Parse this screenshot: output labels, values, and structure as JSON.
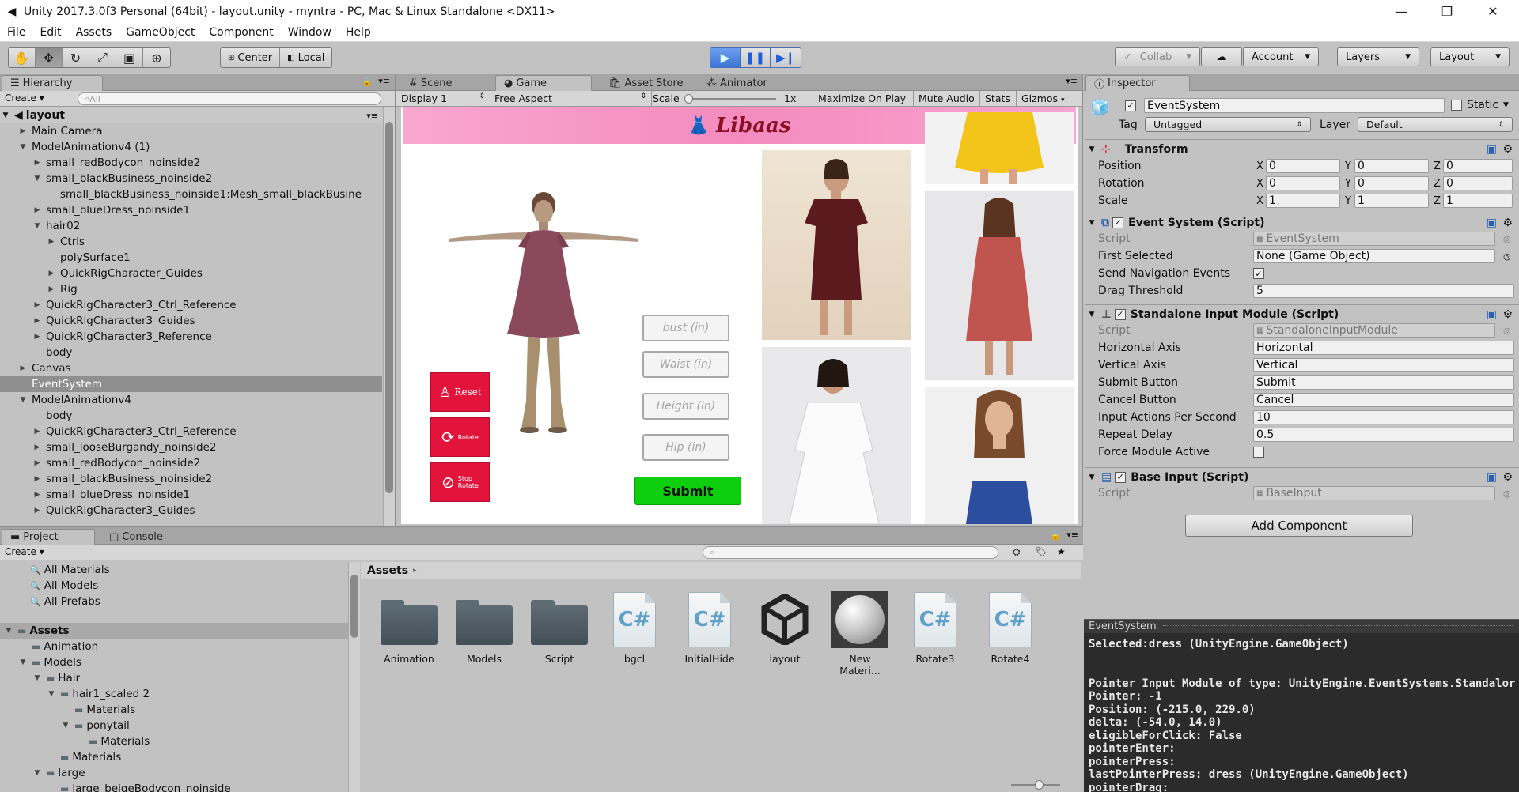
{
  "window": {
    "title": "Unity 2017.3.0f3 Personal (64bit) - layout.unity - myntra - PC, Mac & Linux Standalone <DX11>",
    "minimize": "—",
    "restore": "❐",
    "close": "✕"
  },
  "menu": [
    "File",
    "Edit",
    "Assets",
    "GameObject",
    "Component",
    "Window",
    "Help"
  ],
  "toolbar": {
    "pivot": "Center",
    "space": "Local",
    "collab": "Collab",
    "account": "Account",
    "layers": "Layers",
    "layout": "Layout"
  },
  "hierarchy": {
    "tab": "Hierarchy",
    "create": "Create",
    "search_placeholder": "All",
    "scene": "layout",
    "rows": [
      {
        "label": "Main Camera",
        "indent": 1,
        "tri": "▶"
      },
      {
        "label": "ModelAnimationv4 (1)",
        "indent": 1,
        "tri": "▼"
      },
      {
        "label": "small_redBodycon_noinside2",
        "indent": 2,
        "tri": "▶"
      },
      {
        "label": "small_blackBusiness_noinside2",
        "indent": 2,
        "tri": "▼"
      },
      {
        "label": "small_blackBusiness_noinside1:Mesh_small_blackBusine",
        "indent": 3,
        "tri": ""
      },
      {
        "label": "small_blueDress_noinside1",
        "indent": 2,
        "tri": "▶"
      },
      {
        "label": "hair02",
        "indent": 2,
        "tri": "▼"
      },
      {
        "label": "Ctrls",
        "indent": 3,
        "tri": "▶"
      },
      {
        "label": "polySurface1",
        "indent": 3,
        "tri": ""
      },
      {
        "label": "QuickRigCharacter_Guides",
        "indent": 3,
        "tri": "▶"
      },
      {
        "label": "Rig",
        "indent": 3,
        "tri": "▶"
      },
      {
        "label": "QuickRigCharacter3_Ctrl_Reference",
        "indent": 2,
        "tri": "▶"
      },
      {
        "label": "QuickRigCharacter3_Guides",
        "indent": 2,
        "tri": "▶"
      },
      {
        "label": "QuickRigCharacter3_Reference",
        "indent": 2,
        "tri": "▶"
      },
      {
        "label": "body",
        "indent": 2,
        "tri": ""
      },
      {
        "label": "Canvas",
        "indent": 1,
        "tri": "▶"
      },
      {
        "label": "EventSystem",
        "indent": 1,
        "tri": "",
        "selected": true
      },
      {
        "label": "ModelAnimationv4",
        "indent": 1,
        "tri": "▼"
      },
      {
        "label": "body",
        "indent": 2,
        "tri": ""
      },
      {
        "label": "QuickRigCharacter3_Ctrl_Reference",
        "indent": 2,
        "tri": "▶"
      },
      {
        "label": "small_looseBurgandy_noinside2",
        "indent": 2,
        "tri": "▶"
      },
      {
        "label": "small_redBodycon_noinside2",
        "indent": 2,
        "tri": "▶"
      },
      {
        "label": "small_blackBusiness_noinside2",
        "indent": 2,
        "tri": "▶"
      },
      {
        "label": "small_blueDress_noinside1",
        "indent": 2,
        "tri": "▶"
      },
      {
        "label": "QuickRigCharacter3_Guides",
        "indent": 2,
        "tri": "▶"
      }
    ]
  },
  "center_tabs": {
    "scene": "Scene",
    "game": "Game",
    "asset_store": "Asset Store",
    "animator": "Animator"
  },
  "game_bar": {
    "display": "Display 1",
    "aspect": "Free Aspect",
    "scale_label": "Scale",
    "scale_value": "1x",
    "maximize": "Maximize On Play",
    "mute": "Mute Audio",
    "stats": "Stats",
    "gizmos": "Gizmos"
  },
  "game": {
    "brand": "Libaas",
    "inputs": [
      "bust (in)",
      "Waist (in)",
      "Height (in)",
      "Hip (in)"
    ],
    "submit": "Submit",
    "reset": "Reset",
    "rotate": "Rotate",
    "stop_rotate_1": "Stop",
    "stop_rotate_2": "Rotate"
  },
  "inspector": {
    "tab": "Inspector",
    "object_name": "EventSystem",
    "static_label": "Static",
    "tag_label": "Tag",
    "tag_value": "Untagged",
    "layer_label": "Layer",
    "layer_value": "Default",
    "transform": {
      "title": "Transform",
      "position_label": "Position",
      "rotation_label": "Rotation",
      "scale_label": "Scale",
      "position": [
        "0",
        "0",
        "0"
      ],
      "rotation": [
        "0",
        "0",
        "0"
      ],
      "scale": [
        "1",
        "1",
        "1"
      ],
      "axis_x": "X",
      "axis_y": "Y",
      "axis_z": "Z"
    },
    "event_system": {
      "title": "Event System (Script)",
      "script_label": "Script",
      "script_value": "EventSystem",
      "first_selected_label": "First Selected",
      "first_selected_value": "None (Game Object)",
      "send_nav_label": "Send Navigation Events",
      "drag_label": "Drag Threshold",
      "drag_value": "5"
    },
    "standalone": {
      "title": "Standalone Input Module (Script)",
      "script_label": "Script",
      "script_value": "StandaloneInputModule",
      "horizontal_label": "Horizontal Axis",
      "horizontal_value": "Horizontal",
      "vertical_label": "Vertical Axis",
      "vertical_value": "Vertical",
      "submit_label": "Submit Button",
      "submit_value": "Submit",
      "cancel_label": "Cancel Button",
      "cancel_value": "Cancel",
      "iaps_label": "Input Actions Per Second",
      "iaps_value": "10",
      "repeat_label": "Repeat Delay",
      "repeat_value": "0.5",
      "force_label": "Force Module Active"
    },
    "base_input": {
      "title": "Base Input (Script)",
      "script_label": "Script",
      "script_value": "BaseInput"
    },
    "add_component": "Add Component"
  },
  "project": {
    "tab": "Project",
    "console_tab": "Console",
    "create": "Create",
    "favorites": [
      "All Materials",
      "All Models",
      "All Prefabs"
    ],
    "tree": [
      {
        "label": "Assets",
        "indent": 0,
        "tri": "▼",
        "bold": true
      },
      {
        "label": "Animation",
        "indent": 1,
        "tri": ""
      },
      {
        "label": "Models",
        "indent": 1,
        "tri": "▼"
      },
      {
        "label": "Hair",
        "indent": 2,
        "tri": "▼"
      },
      {
        "label": "hair1_scaled 2",
        "indent": 3,
        "tri": "▼"
      },
      {
        "label": "Materials",
        "indent": 4,
        "tri": ""
      },
      {
        "label": "ponytail",
        "indent": 4,
        "tri": "▼"
      },
      {
        "label": "Materials",
        "indent": 5,
        "tri": ""
      },
      {
        "label": "Materials",
        "indent": 3,
        "tri": ""
      },
      {
        "label": "large",
        "indent": 2,
        "tri": "▼"
      },
      {
        "label": "large_beigeBodycon_noinside",
        "indent": 3,
        "tri": ""
      }
    ],
    "breadcrumb": "Assets",
    "assets": [
      {
        "name": "Animation",
        "kind": "folder"
      },
      {
        "name": "Models",
        "kind": "folder"
      },
      {
        "name": "Script",
        "kind": "folder"
      },
      {
        "name": "bgcl",
        "kind": "cs"
      },
      {
        "name": "InitialHide",
        "kind": "cs"
      },
      {
        "name": "layout",
        "kind": "unity"
      },
      {
        "name": "New Materi...",
        "kind": "material"
      },
      {
        "name": "Rotate3",
        "kind": "cs"
      },
      {
        "name": "Rotate4",
        "kind": "cs"
      }
    ]
  },
  "preview": {
    "title": "EventSystem",
    "lines": [
      "Selected:dress (UnityEngine.GameObject)",
      "",
      "",
      "Pointer Input Module of type: UnityEngine.EventSystems.Standalor",
      "Pointer: -1",
      "Position: (-215.0, 229.0)",
      "delta: (-54.0, 14.0)",
      "eligibleForClick: False",
      "pointerEnter:",
      "pointerPress:",
      "lastPointerPress: dress (UnityEngine.GameObject)",
      "pointerDrag:"
    ]
  }
}
